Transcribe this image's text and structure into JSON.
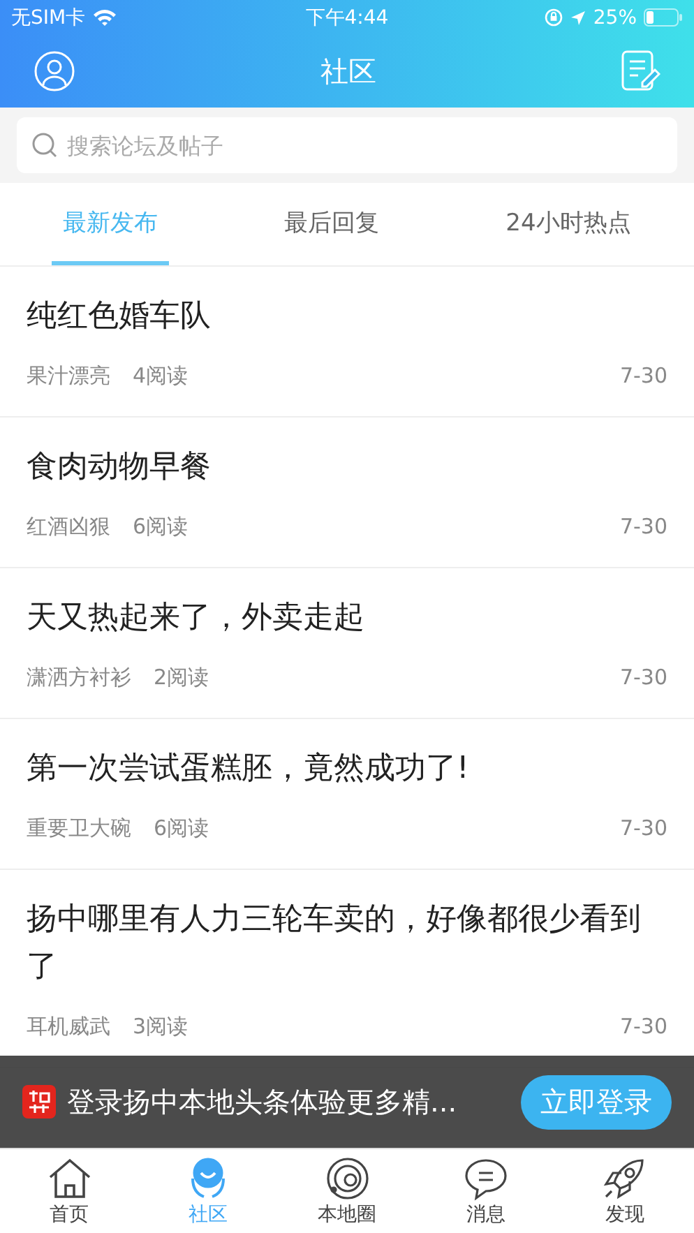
{
  "status_bar": {
    "carrier": "无SIM卡",
    "time": "下午4:44",
    "battery": "25%"
  },
  "header": {
    "title": "社区"
  },
  "search": {
    "placeholder": "搜索论坛及帖子"
  },
  "tabs": [
    {
      "label": "最新发布",
      "selected": true
    },
    {
      "label": "最后回复",
      "selected": false
    },
    {
      "label": "24小时热点",
      "selected": false
    }
  ],
  "posts": [
    {
      "title": "纯红色婚车队",
      "author": "果汁漂亮",
      "reads": "4阅读",
      "date": "7-30"
    },
    {
      "title": "食肉动物早餐",
      "author": "红酒凶狠",
      "reads": "6阅读",
      "date": "7-30"
    },
    {
      "title": "天又热起来了，外卖走起",
      "author": "潇洒方衬衫",
      "reads": "2阅读",
      "date": "7-30"
    },
    {
      "title": "第一次尝试蛋糕胚，竟然成功了!",
      "author": "重要卫大碗",
      "reads": "6阅读",
      "date": "7-30"
    },
    {
      "title": "扬中哪里有人力三轮车卖的，好像都很少看到了",
      "author": "耳机威武",
      "reads": "3阅读",
      "date": "7-30"
    }
  ],
  "login_banner": {
    "text": "登录扬中本地头条体验更多精...",
    "button": "立即登录"
  },
  "bottom_nav": [
    {
      "label": "首页",
      "kind": "home",
      "selected": false
    },
    {
      "label": "社区",
      "kind": "community",
      "selected": true
    },
    {
      "label": "本地圈",
      "kind": "planet",
      "selected": false
    },
    {
      "label": "消息",
      "kind": "chat",
      "selected": false
    },
    {
      "label": "发现",
      "kind": "rocket",
      "selected": false
    }
  ]
}
